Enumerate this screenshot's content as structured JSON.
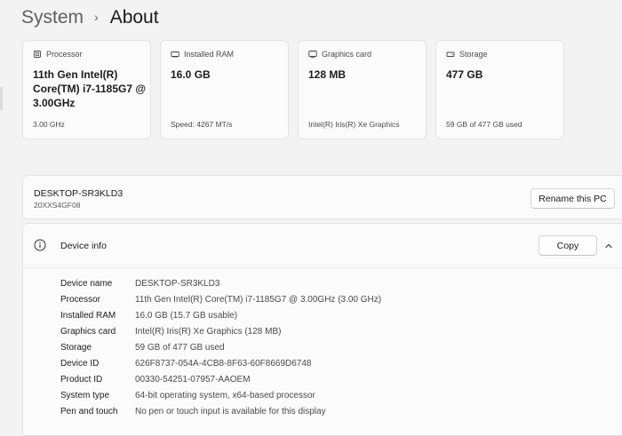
{
  "breadcrumb": {
    "parent": "System",
    "separator": "›",
    "current": "About"
  },
  "spec_cards": [
    {
      "icon": "processor-icon",
      "label": "Processor",
      "value": "11th Gen Intel(R) Core(TM) i7-1185G7 @ 3.00GHz",
      "sub": "3.00 GHz"
    },
    {
      "icon": "ram-icon",
      "label": "Installed RAM",
      "value": "16.0 GB",
      "sub": "Speed: 4267 MT/s"
    },
    {
      "icon": "graphics-card-icon",
      "label": "Graphics card",
      "value": "128 MB",
      "sub": "Intel(R) Iris(R) Xe Graphics"
    },
    {
      "icon": "storage-icon",
      "label": "Storage",
      "value": "477 GB",
      "sub": "59 GB of 477 GB used"
    }
  ],
  "pc": {
    "name": "DESKTOP-SR3KLD3",
    "model": "20XXS4GF08",
    "rename_label": "Rename this PC"
  },
  "device_info": {
    "title": "Device info",
    "copy_label": "Copy",
    "rows": [
      {
        "key": "Device name",
        "value": "DESKTOP-SR3KLD3"
      },
      {
        "key": "Processor",
        "value": "11th Gen Intel(R) Core(TM) i7-1185G7 @ 3.00GHz (3.00 GHz)"
      },
      {
        "key": "Installed RAM",
        "value": "16.0 GB (15.7 GB usable)"
      },
      {
        "key": "Graphics card",
        "value": "Intel(R) Iris(R) Xe Graphics (128 MB)"
      },
      {
        "key": "Storage",
        "value": "59 GB of 477 GB used"
      },
      {
        "key": "Device ID",
        "value": "626F8737-054A-4CB8-8F63-60F8669D6748"
      },
      {
        "key": "Product ID",
        "value": "00330-54251-07957-AAOEM"
      },
      {
        "key": "System type",
        "value": "64-bit operating system, x64-based processor"
      },
      {
        "key": "Pen and touch",
        "value": "No pen or touch input is available for this display"
      }
    ]
  }
}
